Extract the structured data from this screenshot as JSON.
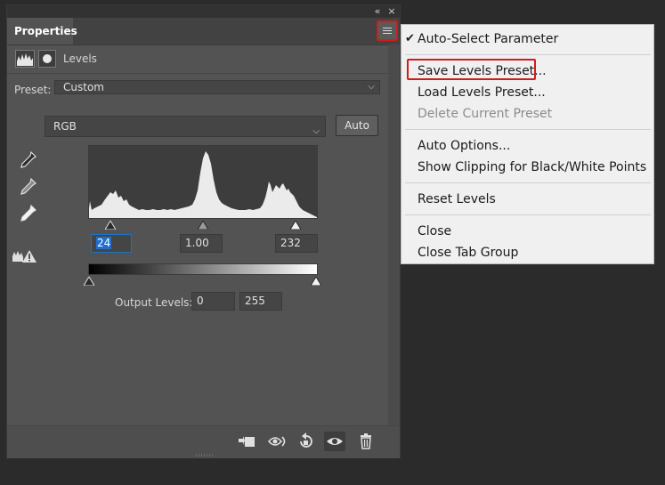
{
  "panel": {
    "tab_title": "Properties",
    "collapse_glyph": "«",
    "close_glyph": "×",
    "menu_icon": "hamburger-icon",
    "adjustment_label": "Levels",
    "preset_label": "Preset:",
    "preset_value": "Custom",
    "channel_value": "RGB",
    "auto_label": "Auto",
    "input_black": "24",
    "input_gamma": "1.00",
    "input_white": "232",
    "output_label": "Output Levels:",
    "output_black": "0",
    "output_white": "255",
    "eyedroppers": [
      "black-eyedropper-icon",
      "gray-eyedropper-icon",
      "white-eyedropper-icon"
    ],
    "bottom_icons": [
      "clip-to-layer-icon",
      "view-previous-icon",
      "reset-icon",
      "visibility-eye-icon",
      "trash-icon"
    ]
  },
  "menu": {
    "items": [
      {
        "label": "Auto-Select Parameter",
        "checked": true
      },
      {
        "label": "Save Levels Preset...",
        "highlighted": true
      },
      {
        "label": "Load Levels Preset..."
      },
      {
        "label": "Delete Current Preset",
        "disabled": true
      },
      {
        "label": "Auto Options..."
      },
      {
        "label": "Show Clipping for Black/White Points"
      },
      {
        "label": "Reset Levels"
      },
      {
        "label": "Close"
      },
      {
        "label": "Close Tab Group"
      }
    ]
  },
  "colors": {
    "panel_bg": "#535353",
    "highlight_red": "#d01c1c",
    "selection_blue": "#1f6fd0",
    "menu_bg": "#f0f0f0"
  }
}
